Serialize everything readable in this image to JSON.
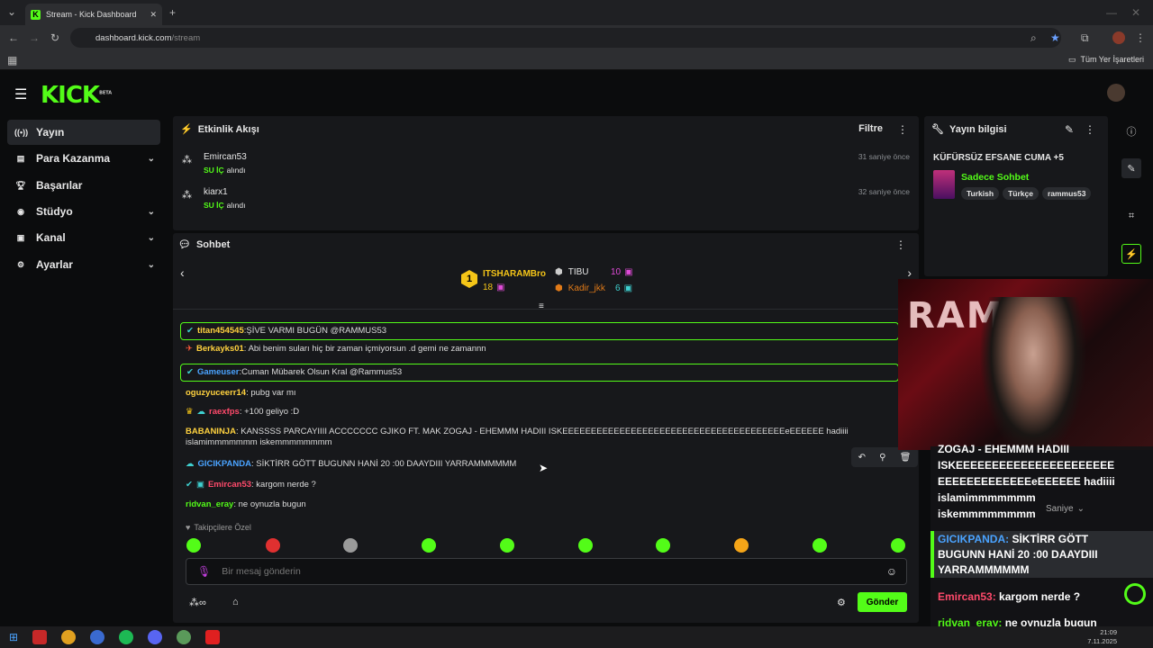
{
  "browser": {
    "tab_title": "Stream - Kick Dashboard",
    "url_host": "dashboard.kick.com",
    "url_path": "/stream",
    "bookmarks": "Tüm Yer İşaretleri"
  },
  "brand": {
    "logo": "KICK",
    "badge": "BETA",
    "accent": "#53fc18"
  },
  "sidebar": {
    "items": [
      {
        "label": "Yayın",
        "icon": "stream-icon"
      },
      {
        "label": "Para Kazanma",
        "icon": "money-icon"
      },
      {
        "label": "Başarılar",
        "icon": "trophy-icon"
      },
      {
        "label": "Stüdyo",
        "icon": "studio-icon"
      },
      {
        "label": "Kanal",
        "icon": "channel-icon"
      },
      {
        "label": "Ayarlar",
        "icon": "settings-icon"
      }
    ]
  },
  "activity": {
    "title": "Etkinlik Akışı",
    "filter": "Filtre",
    "items": [
      {
        "user": "Emircan53",
        "item": "SU İÇ",
        "action": "alındı",
        "time": "31 saniye önce"
      },
      {
        "user": "kiarx1",
        "item": "SU İÇ",
        "action": "alındı",
        "time": "32 saniye önce"
      }
    ]
  },
  "stream_info": {
    "title": "Yayın bilgisi",
    "stream_title": "KÜFÜRSÜZ EFSANE CUMA +5",
    "category": "Sadece Sohbet",
    "tags": [
      "Turkish",
      "Türkçe",
      "rammus53"
    ]
  },
  "chat": {
    "title": "Sohbet",
    "leaderboard": {
      "first": {
        "rank": "1",
        "name": "ITSHARAMBro",
        "count": "18"
      },
      "second": {
        "name": "TIBU",
        "count": "10"
      },
      "third": {
        "name": "Kadir_jkk",
        "count": "6"
      }
    },
    "messages": [
      {
        "user": "titan454545",
        "text": "ŞİVE VARMI BUGÜN @RAMMUS53",
        "color": "#ffd23f"
      },
      {
        "user": "Berkayks01",
        "text": "Abi benim suları hiç bir zaman içmiyorsun .d gemi ne zamannn",
        "color": "#ffd23f"
      },
      {
        "user": "Gameuser",
        "text": "Cuman Mübarek Olsun Kral @Rammus53",
        "color": "#4aa3ff"
      },
      {
        "user": "oguzyuceerr14",
        "text": "pubg var mı",
        "color": "#ffd23f"
      },
      {
        "user": "raexfps",
        "text": "+100 geliyo :D",
        "color": "#ff4a6b"
      },
      {
        "user": "BABANINJA",
        "text": "KANSSSS PARCAYIIII ACCCCCCC GJIKO FT. MAK ZOGAJ - EHEMMM HADIII ISKEEEEEEEEEEEEEEEEEEEEEEEEEEEEEEEEEEEEEEEeEEEEEE hadiiii islamimmmmmmm iskemmmmmmmm",
        "color": "#ffd23f"
      },
      {
        "user": "GICIKPANDA",
        "text": "SİKTİRR GÖTT BUGUNN HANİ 20 :00 DAAYDIII YARRAMMMMMM",
        "color": "#4aa3ff"
      },
      {
        "user": "Emircan53",
        "text": "kargom nerde ?",
        "color": "#ff4a6b"
      },
      {
        "user": "ridvan_eray",
        "text": "ne oynuzla bugun",
        "color": "#53fc18"
      }
    ],
    "followers_only": "Takipçilere Özel",
    "input_placeholder": "Bir mesaj gönderin",
    "send": "Gönder"
  },
  "overlay": {
    "lines": [
      "ZOGAJ - EHEMMM HADIII",
      "ISKEEEEEEEEEEEEEEEEEEEEEE",
      "EEEEEEEEEEEEEeEEEEEE hadiiii",
      "islamimmmmmmm",
      "iskemmmmmmmm"
    ],
    "speed": "Saniye",
    "gicik_user": "GICIKPANDA:",
    "gicik_text": [
      "SİKTİRR GÖTT",
      "BUGUNN HANİ 20 :00 DAAYDIII",
      "YARRAMMMMMM"
    ],
    "emircan_user": "Emircan53:",
    "emircan_text": "kargom nerde ?",
    "ridvan_user": "ridvan_eray:",
    "ridvan_text": "ne oynuzla bugun"
  },
  "taskbar": {
    "time": "21:09",
    "date": "7.11.2025"
  }
}
